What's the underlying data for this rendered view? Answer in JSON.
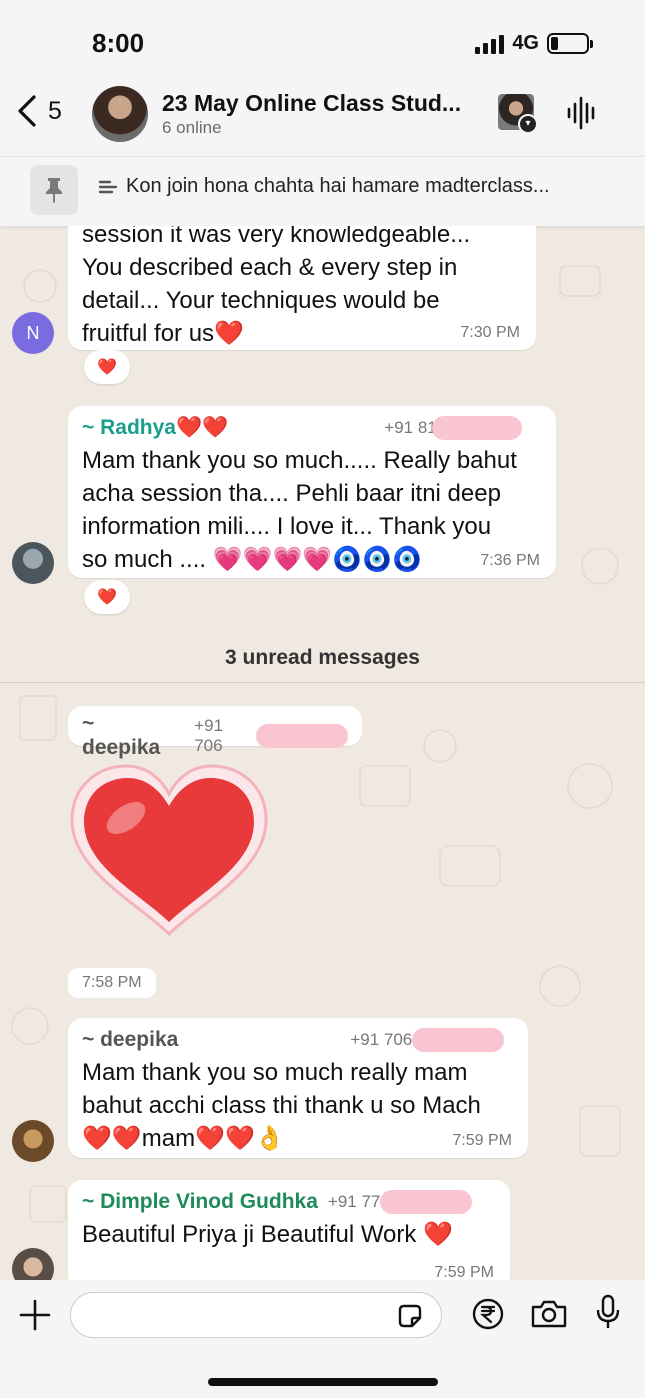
{
  "status_bar": {
    "time": "8:00",
    "network": "4G",
    "battery_level": 0.2
  },
  "header": {
    "back_count": "5",
    "title": "23 May Online Class Stud...",
    "subtitle": "6 online"
  },
  "pinned": {
    "text": "Kon join hona chahta hai hamare madterclass..."
  },
  "messages": {
    "m1": {
      "text": "session it was very knowledgeable...\nYou described each & every step in\ndetail... Your techniques would be\nfruitful for us❤️",
      "time": "7:30 PM",
      "avatar_initial": "N",
      "reaction": "❤️"
    },
    "m2": {
      "sender": "~ Radhya❤️❤️",
      "phone": "+91 812",
      "text": "Mam thank you so much..... Really bahut\nacha session tha.... Pehli baar itni deep\ninformation mili.... I love it... Thank you\nso much .... 💗💗💗💗🧿🧿🧿",
      "time": "7:36 PM",
      "reaction": "❤️"
    },
    "unread": "3 unread messages",
    "m3": {
      "sender": "~ deepika",
      "phone": "+91 706",
      "time": "7:58 PM"
    },
    "m4": {
      "sender": "~ deepika",
      "phone": "+91 706",
      "text": "Mam thank you so much really mam\nbahut acchi class thi thank u so Mach\n❤️❤️mam❤️❤️👌",
      "time": "7:59 PM"
    },
    "m5": {
      "sender": "~ Dimple Vinod Gudhka",
      "phone": "+91 77",
      "text": "Beautiful Priya ji Beautiful Work ❤️",
      "time": "7:59 PM"
    }
  },
  "colors": {
    "radhya": "#1a9e8e",
    "deepika": "#555555",
    "dimple": "#1f8a5b",
    "avatar_n": "#7a6ce0",
    "heart": "#e83a3a"
  },
  "icons": [
    "back-chevron-icon",
    "waveform-icon",
    "pin-icon",
    "list-icon",
    "plus-icon",
    "sticker-icon",
    "rupee-icon",
    "camera-icon",
    "mic-icon"
  ]
}
